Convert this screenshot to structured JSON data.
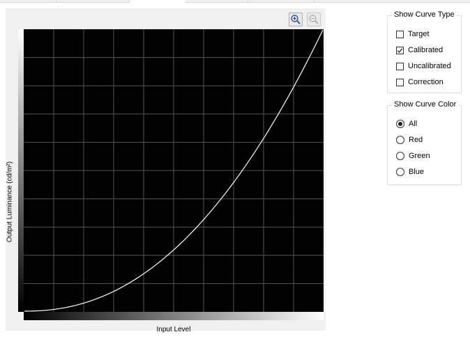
{
  "chart": {
    "y_label": "Output Luminance (cd/m²)",
    "x_label": "Input Level"
  },
  "toolbar": {
    "zoom_in_icon": "zoom-in-icon",
    "zoom_out_icon": "zoom-out-icon"
  },
  "curve_type": {
    "title": "Show Curve Type",
    "options": [
      {
        "label": "Target",
        "checked": false
      },
      {
        "label": "Calibrated",
        "checked": true
      },
      {
        "label": "Uncalibrated",
        "checked": false
      },
      {
        "label": "Correction",
        "checked": false
      }
    ]
  },
  "curve_color": {
    "title": "Show Curve Color",
    "options": [
      {
        "label": "All",
        "selected": true
      },
      {
        "label": "Red",
        "selected": false
      },
      {
        "label": "Green",
        "selected": false
      },
      {
        "label": "Blue",
        "selected": false
      }
    ]
  },
  "colors": {
    "plot_background": "#000000",
    "grid": "#555555",
    "curve": "#ffffff",
    "panel": "#f0f0f0"
  },
  "chart_data": {
    "type": "line",
    "curve_exponent": 2.2,
    "grid_divisions_x": 10,
    "grid_divisions_y": 10,
    "grid": true,
    "series": [
      {
        "x": [
          0,
          0.05,
          0.1,
          0.15,
          0.2,
          0.25,
          0.3,
          0.35,
          0.4,
          0.45,
          0.5,
          0.55,
          0.6,
          0.65,
          0.7,
          0.75,
          0.8,
          0.85,
          0.9,
          0.95,
          1.0
        ],
        "y": [
          0,
          0.001,
          0.006,
          0.015,
          0.029,
          0.047,
          0.071,
          0.099,
          0.133,
          0.173,
          0.218,
          0.268,
          0.325,
          0.388,
          0.456,
          0.531,
          0.612,
          0.699,
          0.793,
          0.893,
          1.0
        ]
      }
    ]
  }
}
